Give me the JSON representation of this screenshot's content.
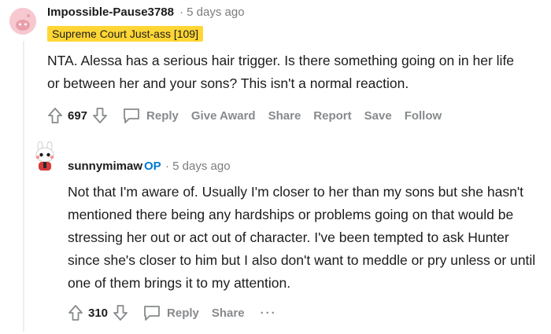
{
  "comments": [
    {
      "username": "Impossible-Pause3788",
      "meta": "· 5 days ago",
      "flair": "Supreme Court Just-ass [109]",
      "body": "NTA. Alessa has a serious hair trigger. Is there something going on in her life or between her and your sons? This isn't a normal reaction.",
      "votes": "697",
      "actions": {
        "reply": "Reply",
        "give_award": "Give Award",
        "share": "Share",
        "report": "Report",
        "save": "Save",
        "follow": "Follow"
      }
    },
    {
      "username": "sunnymimaw",
      "op": "OP",
      "meta": "· 5 days ago",
      "body": "Not that I'm aware of. Usually I'm closer to her than my sons but she hasn't mentioned there being any hardships or problems going on that would be stressing her out or act out of character. I've been tempted to ask Hunter since she's closer to him but I also don't want to meddle or pry unless or until one of them brings it to my attention.",
      "votes": "310",
      "actions": {
        "reply": "Reply",
        "share": "Share",
        "more": "···"
      }
    }
  ],
  "icons": {
    "upvote": "upvote-arrow-icon",
    "downvote": "downvote-arrow-icon",
    "reply": "speech-bubble-icon",
    "more": "ellipsis-icon"
  },
  "colors": {
    "flair_bg": "#ffd635",
    "op_blue": "#0079d3",
    "action_gray": "#878a8c",
    "avatar_pink": "#f7c8cf"
  }
}
